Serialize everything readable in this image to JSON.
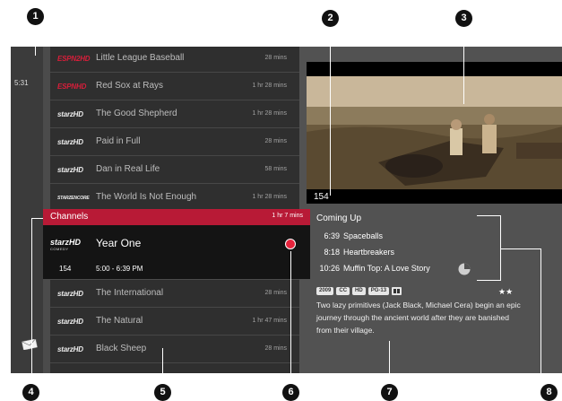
{
  "callouts": [
    "1",
    "2",
    "3",
    "4",
    "5",
    "6",
    "7",
    "8"
  ],
  "clock": "5:31",
  "guide_rows": [
    {
      "logo": "ESPN2HD",
      "logo_color": "red",
      "title": "Little League Baseball",
      "duration": "28 mins"
    },
    {
      "logo": "ESPNHD",
      "logo_color": "red",
      "title": "Red Sox at Rays",
      "duration": "1 hr 28 mins"
    },
    {
      "logo": "starzHD",
      "logo_color": "white",
      "title": "The Good Shepherd",
      "duration": "1 hr 28 mins"
    },
    {
      "logo": "starzHD",
      "logo_color": "white",
      "title": "Paid in Full",
      "duration": "28 mins"
    },
    {
      "logo": "starzHD",
      "logo_color": "white",
      "title": "Dan in Real Life",
      "duration": "58 mins"
    },
    {
      "logo": "STARZENCORE",
      "logo_color": "white",
      "title": "The World Is Not Enough",
      "duration": "1 hr 28 mins"
    }
  ],
  "channels_header": {
    "label": "Channels",
    "time": "1 hr 7 mins"
  },
  "selected": {
    "logo": "starzHD",
    "logo_sub": "COMEDY",
    "title": "Year One",
    "channel": "154",
    "time": "5:00 - 6:39 PM"
  },
  "guide_rows_below": [
    {
      "logo": "starzHD",
      "logo_color": "white",
      "title": "The International",
      "duration": "28 mins"
    },
    {
      "logo": "starzHD",
      "logo_color": "white",
      "title": "The Natural",
      "duration": "1 hr 47 mins"
    },
    {
      "logo": "starzHD",
      "logo_color": "white",
      "title": "Black Sheep",
      "duration": "28 mins"
    }
  ],
  "video": {
    "channel": "154"
  },
  "coming_up": {
    "label": "Coming Up",
    "items": [
      {
        "time": "6:39",
        "title": "Spaceballs"
      },
      {
        "time": "8:18",
        "title": "Heartbreakers"
      },
      {
        "time": "10:26",
        "title": "Muffin Top: A Love Story"
      }
    ]
  },
  "meta": {
    "badges": [
      "2009",
      "CC",
      "HD",
      "PG-13"
    ],
    "stars": "★★"
  },
  "description": "Two lazy primitives (Jack Black, Michael Cera) begin an epic journey through the ancient world after they are banished from their village.",
  "colors": {
    "accent": "#b81a36",
    "record": "#e6233c",
    "guide_bg": "#2f2f2f",
    "panel_bg": "#525252"
  }
}
